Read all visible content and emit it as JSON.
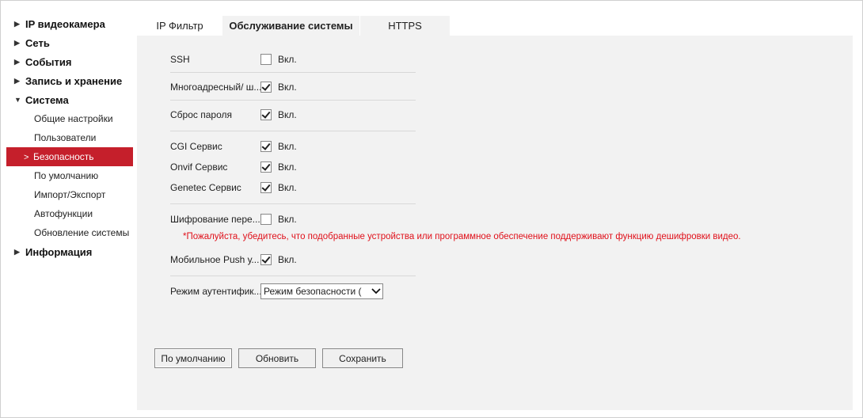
{
  "sidebar": {
    "top": [
      {
        "label": "IP видеокамера"
      },
      {
        "label": "Сеть"
      },
      {
        "label": "События"
      },
      {
        "label": "Запись и хранение"
      },
      {
        "label": "Система"
      }
    ],
    "sub": [
      {
        "label": "Общие настройки"
      },
      {
        "label": "Пользователи"
      },
      {
        "label": "Безопасность"
      },
      {
        "label": "По умолчанию"
      },
      {
        "label": "Импорт/Экспорт"
      },
      {
        "label": "Автофункции"
      },
      {
        "label": "Обновление системы"
      }
    ],
    "info": {
      "label": "Информация"
    }
  },
  "tabs": [
    {
      "label": "IP Фильтр"
    },
    {
      "label": "Обслуживание системы"
    },
    {
      "label": "HTTPS"
    }
  ],
  "form": {
    "checkbox_label": "Вкл.",
    "ssh": {
      "label": "SSH",
      "checked": false
    },
    "multicast": {
      "label": "Многоадресный/ ш...",
      "checked": true
    },
    "reset_password": {
      "label": "Сброс пароля",
      "checked": true
    },
    "cgi": {
      "label": "CGI Сервис",
      "checked": true
    },
    "onvif": {
      "label": "Onvif Сервис",
      "checked": true
    },
    "genetec": {
      "label": "Genetec Сервис",
      "checked": true
    },
    "encryption": {
      "label": "Шифрование пере...",
      "checked": false
    },
    "encryption_note": "*Пожалуйста, убедитесь, что подобранные устройства или программное обеспечение поддерживают функцию дешифровки видео.",
    "mobile_push": {
      "label": "Мобильное Push у...",
      "checked": true
    },
    "auth_mode": {
      "label": "Режим аутентифик...",
      "value": "Режим безопасности ("
    }
  },
  "buttons": {
    "default": "По умолчанию",
    "refresh": "Обновить",
    "save": "Сохранить"
  },
  "colors": {
    "active_nav": "#c51f2b",
    "note_text": "#e0101a",
    "content_bg": "#f2f2f2"
  }
}
